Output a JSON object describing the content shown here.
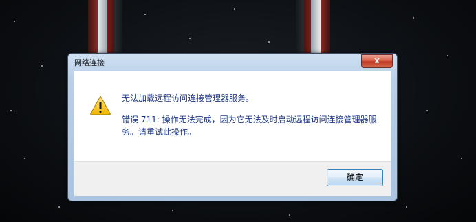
{
  "dialog": {
    "title": "网络连接",
    "close_symbol": "x",
    "message_main": "无法加载远程访问连接管理器服务。",
    "message_detail": "错误 711: 操作无法完成，因为它无法及时启动远程访问连接管理器服务。请重试此操作。",
    "ok_label": "确定",
    "icon": "warning-icon"
  },
  "colors": {
    "message_text": "#1e3a8a",
    "close_button": "#c23b26",
    "warning_yellow": "#f4c21b"
  }
}
